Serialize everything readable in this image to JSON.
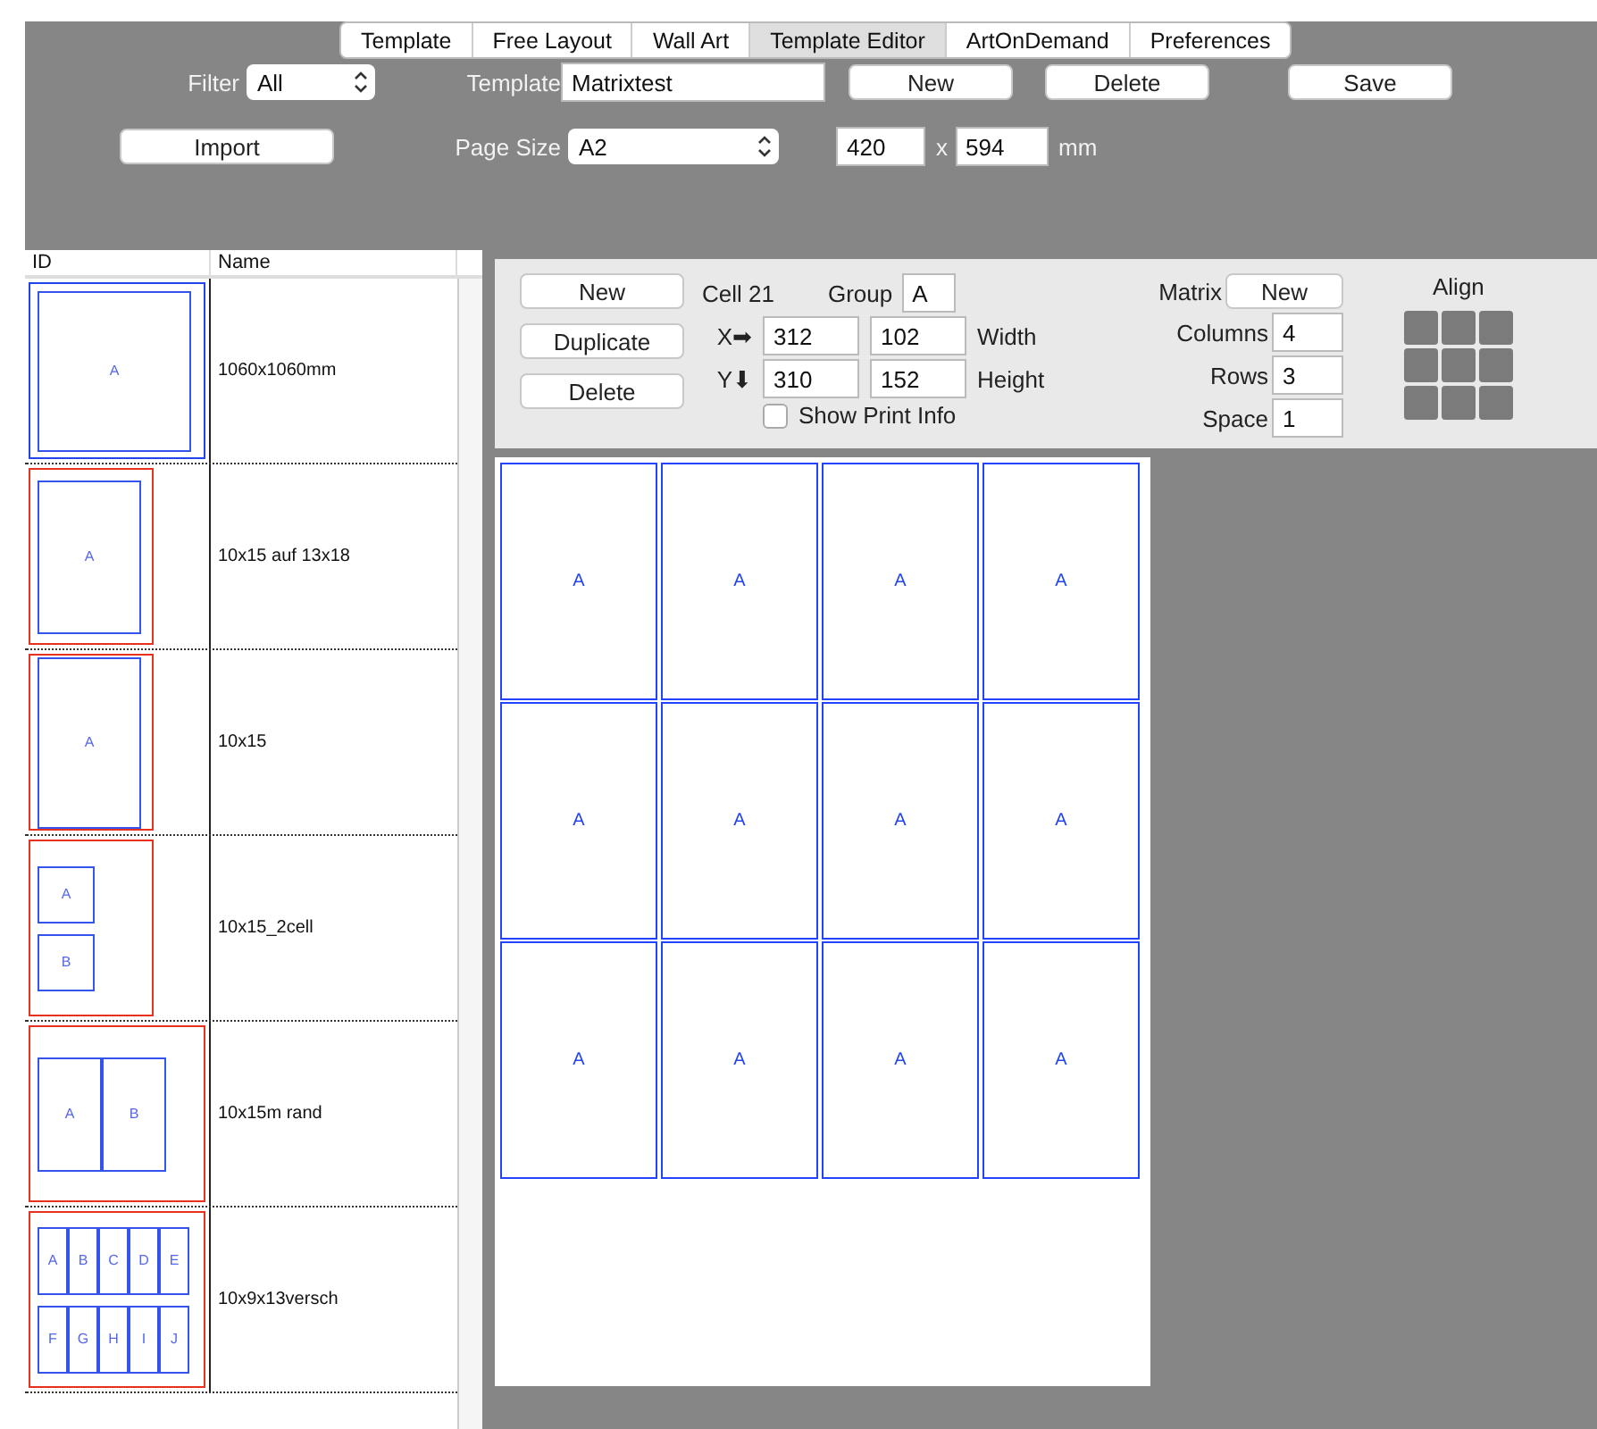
{
  "tabs": [
    {
      "label": "Template",
      "selected": false
    },
    {
      "label": "Free Layout",
      "selected": false
    },
    {
      "label": "Wall Art",
      "selected": false
    },
    {
      "label": "Template Editor",
      "selected": true
    },
    {
      "label": "ArtOnDemand",
      "selected": false
    },
    {
      "label": "Preferences",
      "selected": false
    }
  ],
  "toolbar": {
    "filter_label": "Filter",
    "filter_value": "All",
    "import_button": "Import",
    "template_label": "Template",
    "template_value": "Matrixtest",
    "new_button": "New",
    "delete_button": "Delete",
    "save_button": "Save",
    "page_size_label": "Page Size",
    "page_size_value": "A2",
    "width_value": "420",
    "times": "x",
    "height_value": "594",
    "unit": "mm"
  },
  "table": {
    "columns": [
      "ID",
      "Name"
    ],
    "rows": [
      {
        "name": "1060x1060mm",
        "cell_rows": [
          [
            "A"
          ]
        ]
      },
      {
        "name": "10x15 auf 13x18",
        "cell_rows": [
          [
            "A"
          ]
        ]
      },
      {
        "name": "10x15",
        "cell_rows": [
          [
            "A"
          ]
        ]
      },
      {
        "name": "10x15_2cell",
        "cell_rows": [
          [
            "A"
          ],
          [
            "B"
          ]
        ]
      },
      {
        "name": "10x15m rand",
        "cell_rows": [
          [
            "A",
            "B"
          ]
        ]
      },
      {
        "name": "10x9x13versch",
        "cell_rows": [
          [
            "A",
            "B",
            "C",
            "D",
            "E"
          ],
          [
            "F",
            "G",
            "H",
            "I",
            "J"
          ]
        ]
      }
    ]
  },
  "cell_panel": {
    "new_button": "New",
    "duplicate_button": "Duplicate",
    "delete_button": "Delete",
    "cell_label": "Cell 21",
    "group_label": "Group",
    "group_value": "A",
    "x_label": "X➡",
    "x_value": "312",
    "width_value": "102",
    "width_label": "Width",
    "y_label": "Y⬇",
    "y_value": "310",
    "height_value": "152",
    "height_label": "Height",
    "show_print_info": {
      "label": "Show Print Info",
      "checked": false
    },
    "matrix_label": "Matrix",
    "matrix_new_button": "New",
    "columns_label": "Columns",
    "columns_value": "4",
    "rows_label": "Rows",
    "rows_value": "3",
    "space_label": "Space",
    "space_value": "1",
    "align_label": "Align"
  },
  "canvas": {
    "cell_rows": [
      [
        "A",
        "A",
        "A",
        "A"
      ],
      [
        "A",
        "A",
        "A",
        "A"
      ],
      [
        "A",
        "A",
        "A",
        "A"
      ]
    ]
  }
}
